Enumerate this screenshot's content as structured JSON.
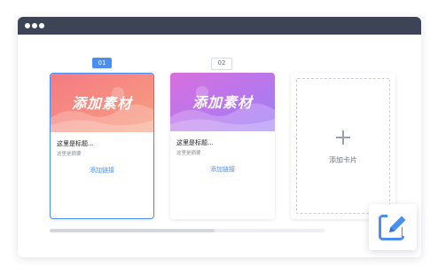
{
  "window": {
    "title": ""
  },
  "cards": [
    {
      "index_label": "01",
      "banner_text": "添加素材",
      "title": "这里是标题...",
      "summary": "这里是摘要",
      "link_label": "添加链接",
      "selected": true,
      "gradient": [
        "#f57a84",
        "#f6a07f"
      ]
    },
    {
      "index_label": "02",
      "banner_text": "添加素材",
      "title": "这里是标题...",
      "summary": "这里是摘要",
      "link_label": "添加链接",
      "selected": false,
      "gradient": [
        "#d86fde",
        "#9c7ef7"
      ]
    }
  ],
  "add_card": {
    "label": "添加卡片",
    "icon": "plus-icon"
  },
  "scrollbar": {
    "position": 0.0,
    "visible_fraction": 0.6
  },
  "edit_button": {
    "icon": "edit-pencil-icon",
    "color": "#4a8ef0"
  },
  "colors": {
    "accent": "#4a8ef0",
    "titlebar": "#3c4455"
  }
}
